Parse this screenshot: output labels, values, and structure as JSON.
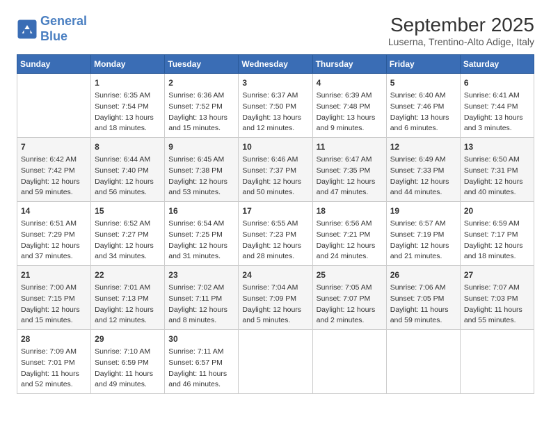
{
  "logo": {
    "line1": "General",
    "line2": "Blue"
  },
  "title": "September 2025",
  "subtitle": "Luserna, Trentino-Alto Adige, Italy",
  "days_of_week": [
    "Sunday",
    "Monday",
    "Tuesday",
    "Wednesday",
    "Thursday",
    "Friday",
    "Saturday"
  ],
  "weeks": [
    [
      {
        "day": "",
        "content": ""
      },
      {
        "day": "1",
        "content": "Sunrise: 6:35 AM\nSunset: 7:54 PM\nDaylight: 13 hours\nand 18 minutes."
      },
      {
        "day": "2",
        "content": "Sunrise: 6:36 AM\nSunset: 7:52 PM\nDaylight: 13 hours\nand 15 minutes."
      },
      {
        "day": "3",
        "content": "Sunrise: 6:37 AM\nSunset: 7:50 PM\nDaylight: 13 hours\nand 12 minutes."
      },
      {
        "day": "4",
        "content": "Sunrise: 6:39 AM\nSunset: 7:48 PM\nDaylight: 13 hours\nand 9 minutes."
      },
      {
        "day": "5",
        "content": "Sunrise: 6:40 AM\nSunset: 7:46 PM\nDaylight: 13 hours\nand 6 minutes."
      },
      {
        "day": "6",
        "content": "Sunrise: 6:41 AM\nSunset: 7:44 PM\nDaylight: 13 hours\nand 3 minutes."
      }
    ],
    [
      {
        "day": "7",
        "content": "Sunrise: 6:42 AM\nSunset: 7:42 PM\nDaylight: 12 hours\nand 59 minutes."
      },
      {
        "day": "8",
        "content": "Sunrise: 6:44 AM\nSunset: 7:40 PM\nDaylight: 12 hours\nand 56 minutes."
      },
      {
        "day": "9",
        "content": "Sunrise: 6:45 AM\nSunset: 7:38 PM\nDaylight: 12 hours\nand 53 minutes."
      },
      {
        "day": "10",
        "content": "Sunrise: 6:46 AM\nSunset: 7:37 PM\nDaylight: 12 hours\nand 50 minutes."
      },
      {
        "day": "11",
        "content": "Sunrise: 6:47 AM\nSunset: 7:35 PM\nDaylight: 12 hours\nand 47 minutes."
      },
      {
        "day": "12",
        "content": "Sunrise: 6:49 AM\nSunset: 7:33 PM\nDaylight: 12 hours\nand 44 minutes."
      },
      {
        "day": "13",
        "content": "Sunrise: 6:50 AM\nSunset: 7:31 PM\nDaylight: 12 hours\nand 40 minutes."
      }
    ],
    [
      {
        "day": "14",
        "content": "Sunrise: 6:51 AM\nSunset: 7:29 PM\nDaylight: 12 hours\nand 37 minutes."
      },
      {
        "day": "15",
        "content": "Sunrise: 6:52 AM\nSunset: 7:27 PM\nDaylight: 12 hours\nand 34 minutes."
      },
      {
        "day": "16",
        "content": "Sunrise: 6:54 AM\nSunset: 7:25 PM\nDaylight: 12 hours\nand 31 minutes."
      },
      {
        "day": "17",
        "content": "Sunrise: 6:55 AM\nSunset: 7:23 PM\nDaylight: 12 hours\nand 28 minutes."
      },
      {
        "day": "18",
        "content": "Sunrise: 6:56 AM\nSunset: 7:21 PM\nDaylight: 12 hours\nand 24 minutes."
      },
      {
        "day": "19",
        "content": "Sunrise: 6:57 AM\nSunset: 7:19 PM\nDaylight: 12 hours\nand 21 minutes."
      },
      {
        "day": "20",
        "content": "Sunrise: 6:59 AM\nSunset: 7:17 PM\nDaylight: 12 hours\nand 18 minutes."
      }
    ],
    [
      {
        "day": "21",
        "content": "Sunrise: 7:00 AM\nSunset: 7:15 PM\nDaylight: 12 hours\nand 15 minutes."
      },
      {
        "day": "22",
        "content": "Sunrise: 7:01 AM\nSunset: 7:13 PM\nDaylight: 12 hours\nand 12 minutes."
      },
      {
        "day": "23",
        "content": "Sunrise: 7:02 AM\nSunset: 7:11 PM\nDaylight: 12 hours\nand 8 minutes."
      },
      {
        "day": "24",
        "content": "Sunrise: 7:04 AM\nSunset: 7:09 PM\nDaylight: 12 hours\nand 5 minutes."
      },
      {
        "day": "25",
        "content": "Sunrise: 7:05 AM\nSunset: 7:07 PM\nDaylight: 12 hours\nand 2 minutes."
      },
      {
        "day": "26",
        "content": "Sunrise: 7:06 AM\nSunset: 7:05 PM\nDaylight: 11 hours\nand 59 minutes."
      },
      {
        "day": "27",
        "content": "Sunrise: 7:07 AM\nSunset: 7:03 PM\nDaylight: 11 hours\nand 55 minutes."
      }
    ],
    [
      {
        "day": "28",
        "content": "Sunrise: 7:09 AM\nSunset: 7:01 PM\nDaylight: 11 hours\nand 52 minutes."
      },
      {
        "day": "29",
        "content": "Sunrise: 7:10 AM\nSunset: 6:59 PM\nDaylight: 11 hours\nand 49 minutes."
      },
      {
        "day": "30",
        "content": "Sunrise: 7:11 AM\nSunset: 6:57 PM\nDaylight: 11 hours\nand 46 minutes."
      },
      {
        "day": "",
        "content": ""
      },
      {
        "day": "",
        "content": ""
      },
      {
        "day": "",
        "content": ""
      },
      {
        "day": "",
        "content": ""
      }
    ]
  ]
}
